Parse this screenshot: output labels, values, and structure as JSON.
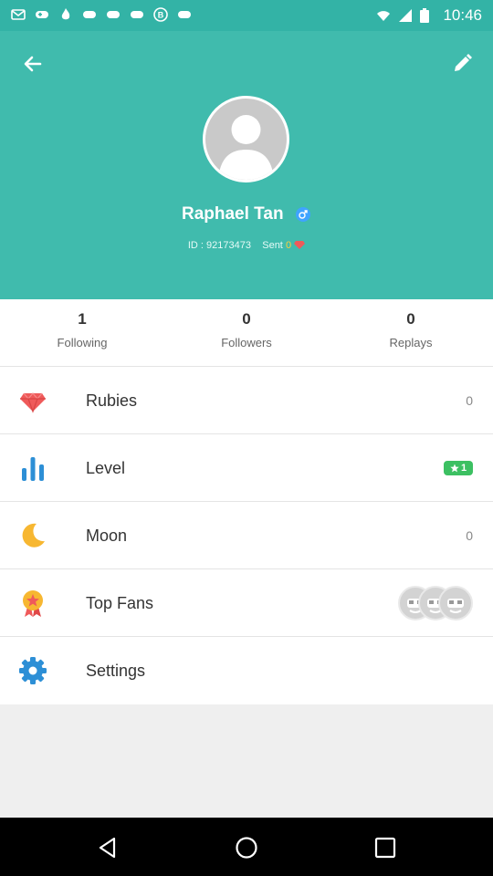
{
  "status_bar": {
    "time": "10:46"
  },
  "profile": {
    "name": "Raphael Tan",
    "gender_symbol": "♂",
    "id_label": "ID :",
    "id_value": "92173473",
    "sent_label": "Sent",
    "sent_count": "0"
  },
  "stats": [
    {
      "value": "1",
      "label": "Following"
    },
    {
      "value": "0",
      "label": "Followers"
    },
    {
      "value": "0",
      "label": "Replays"
    }
  ],
  "menu": {
    "rubies": {
      "label": "Rubies",
      "value": "0"
    },
    "level": {
      "label": "Level",
      "value": "1"
    },
    "moon": {
      "label": "Moon",
      "value": "0"
    },
    "top_fans": {
      "label": "Top Fans"
    },
    "settings": {
      "label": "Settings"
    }
  },
  "colors": {
    "header": "#40bbad",
    "status_bar": "#33b3a6",
    "level_badge": "#3cc062",
    "ruby": "#ef5a5a",
    "level_icon": "#2d8fd6",
    "moon": "#f7b731",
    "settings": "#2d8fd6"
  },
  "icons": {
    "back": "arrow-left-icon",
    "edit": "pencil-icon",
    "rubies": "ruby-icon",
    "level": "bar-chart-icon",
    "moon": "moon-icon",
    "top_fans": "medal-icon",
    "settings": "gear-icon"
  }
}
